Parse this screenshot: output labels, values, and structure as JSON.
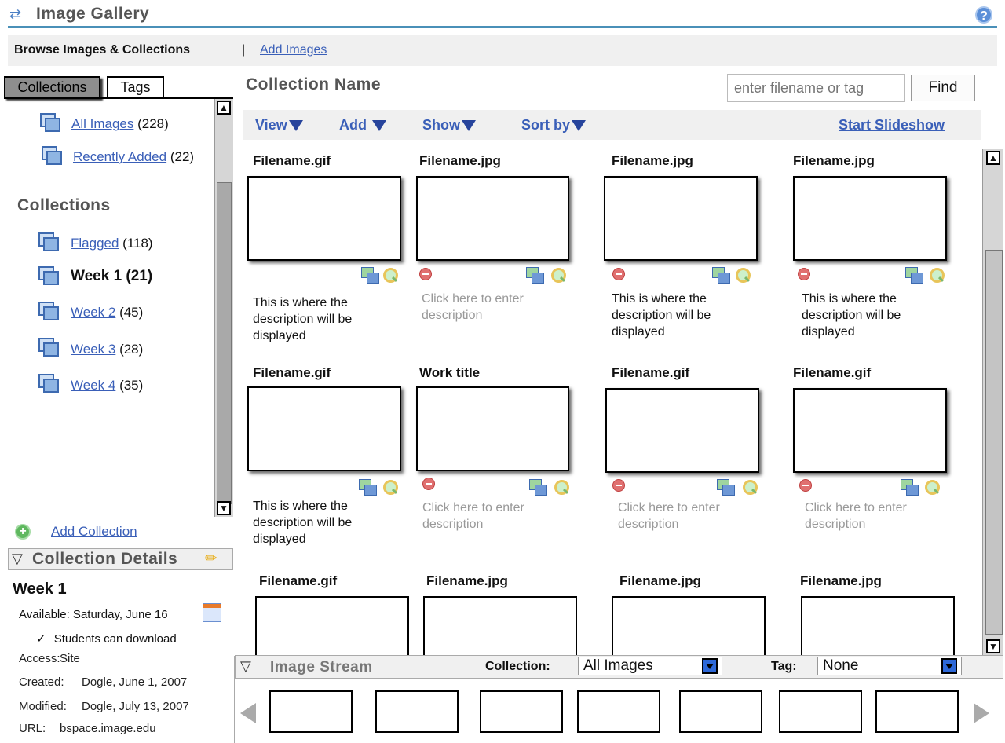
{
  "header": {
    "title": "Image Gallery",
    "help": "?"
  },
  "nav": {
    "browse": "Browse Images & Collections",
    "sep": "|",
    "add_images": "Add Images"
  },
  "left": {
    "tabs": [
      "Collections",
      "Tags"
    ],
    "top_items": [
      {
        "label": "All Images",
        "count": "(228)"
      },
      {
        "label": "Recently Added",
        "count": "(22)"
      }
    ],
    "section_title": "Collections",
    "collections": [
      {
        "label": "Flagged",
        "count": "(118)"
      },
      {
        "label": "Week 1 (21)",
        "count": ""
      },
      {
        "label": "Week 2",
        "count": "(45)"
      },
      {
        "label": "Week 3",
        "count": "(28)"
      },
      {
        "label": "Week 4",
        "count": "(35)"
      }
    ],
    "add_collection": "Add Collection"
  },
  "details": {
    "header": "Collection Details",
    "name": "Week 1",
    "available": "Available: Saturday, June 16",
    "download": "Students can download",
    "rows": [
      {
        "label": "Access:",
        "value": "Site"
      },
      {
        "label": "Created:",
        "value": "Dogle, June 1, 2007"
      },
      {
        "label": "Modified:",
        "value": "Dogle, July 13, 2007"
      },
      {
        "label": "URL:",
        "value": "bspace.image.edu"
      }
    ]
  },
  "main": {
    "title": "Collection Name",
    "search_placeholder": "enter filename or tag",
    "find": "Find",
    "toolbar": [
      "View",
      "Add",
      "Show",
      "Sort by"
    ],
    "slideshow": "Start Slideshow",
    "rows": [
      [
        {
          "name": "Filename.gif",
          "desc": "This is where the description will be displayed",
          "placeholder": false
        },
        {
          "name": "Filename.jpg",
          "desc": "Click here to enter description",
          "placeholder": true
        },
        {
          "name": "Filename.jpg",
          "desc": "This is where the description will be displayed",
          "placeholder": false
        },
        {
          "name": "Filename.jpg",
          "desc": "This is where the description will be displayed",
          "placeholder": false
        }
      ],
      [
        {
          "name": "Filename.gif",
          "desc": "This is where the description will be displayed",
          "placeholder": false
        },
        {
          "name": "Work title",
          "desc": "Click here to enter description",
          "placeholder": true
        },
        {
          "name": "Filename.gif",
          "desc": "Click here to enter description",
          "placeholder": true
        },
        {
          "name": "Filename.gif",
          "desc": "Click here to enter description",
          "placeholder": true
        }
      ],
      [
        {
          "name": "Filename.gif"
        },
        {
          "name": "Filename.jpg"
        },
        {
          "name": "Filename.jpg"
        },
        {
          "name": "Filename.jpg"
        }
      ]
    ]
  },
  "stream": {
    "title": "Image Stream",
    "collection_label": "Collection:",
    "collection_value": "All Images",
    "tag_label": "Tag:",
    "tag_value": "None"
  }
}
